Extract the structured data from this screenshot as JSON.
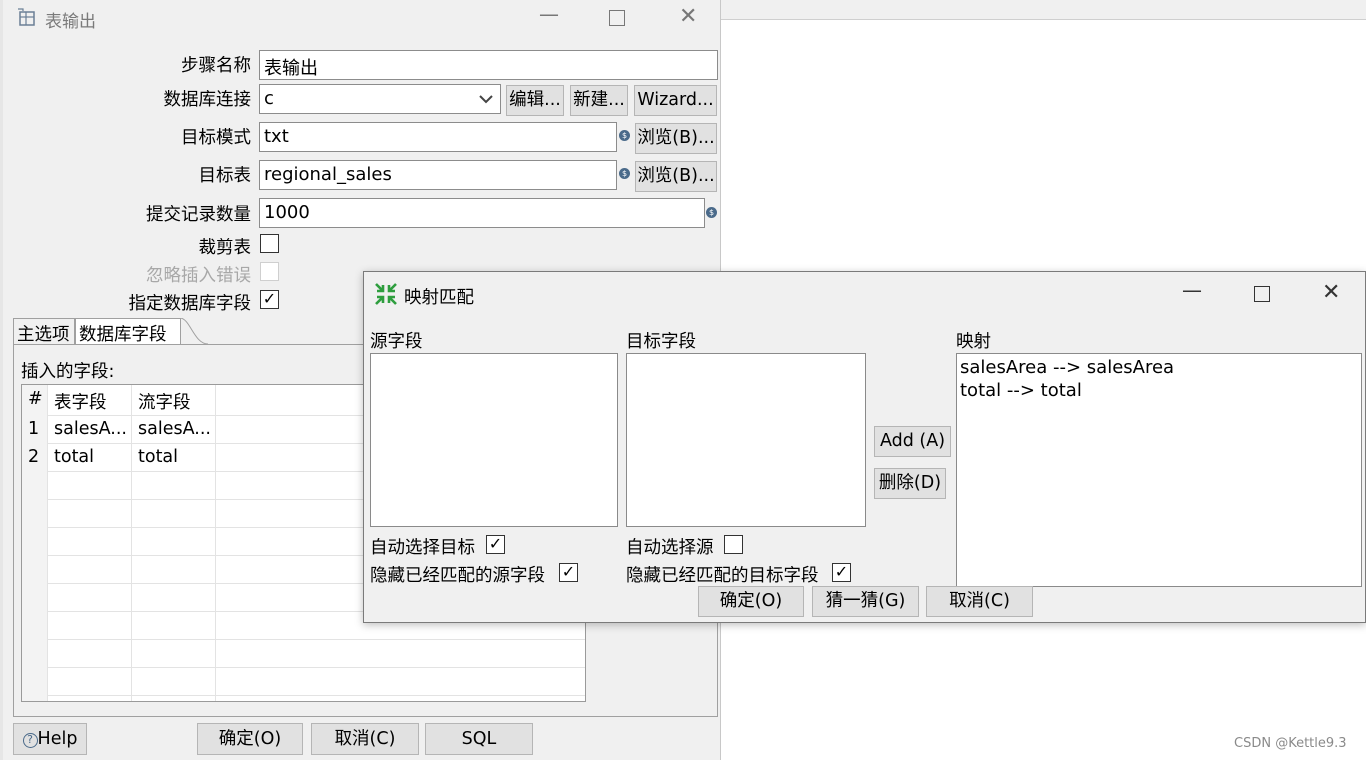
{
  "main_window": {
    "title": "表输出",
    "fields": {
      "step_name": {
        "label": "步骤名称",
        "value": "表输出"
      },
      "connection": {
        "label": "数据库连接",
        "value": "c"
      },
      "target_schema": {
        "label": "目标模式",
        "value": "txt"
      },
      "target_table": {
        "label": "目标表",
        "value": "regional_sales"
      },
      "commit_size": {
        "label": "提交记录数量",
        "value": "1000"
      },
      "truncate": {
        "label": "裁剪表",
        "checked": false
      },
      "ignore_errors": {
        "label": "忽略插入错误",
        "checked": false
      },
      "specify_fields": {
        "label": "指定数据库字段",
        "checked": true,
        "check_mark": "✓"
      }
    },
    "buttons": {
      "edit": "编辑...",
      "new": "新建...",
      "wizard": "Wizard...",
      "browse_schema": "浏览(B)...",
      "browse_table": "浏览(B)...",
      "help": "Help",
      "ok": "确定(O)",
      "cancel": "取消(C)",
      "sql": "SQL"
    },
    "var_icon": "$",
    "tabs": [
      "主选项",
      "数据库字段"
    ],
    "insert_fields_label": "插入的字段:",
    "table": {
      "headers": [
        "#",
        "表字段",
        "流字段"
      ],
      "rows": [
        {
          "num": "1",
          "table_field": "salesA...",
          "stream_field": "salesA..."
        },
        {
          "num": "2",
          "table_field": "total",
          "stream_field": "total"
        }
      ]
    }
  },
  "mapping_dialog": {
    "title": "映射匹配",
    "source_label": "源字段",
    "target_label": "目标字段",
    "mapping_label": "映射",
    "mappings": [
      "salesArea --> salesArea",
      "total --> total"
    ],
    "add_button": "Add (A)",
    "delete_button": "删除(D)",
    "auto_target": {
      "label": "自动选择目标",
      "checked": true
    },
    "hide_source": {
      "label": "隐藏已经匹配的源字段",
      "checked": true
    },
    "auto_source": {
      "label": "自动选择源",
      "checked": false
    },
    "hide_target": {
      "label": "隐藏已经匹配的目标字段",
      "checked": true
    },
    "ok_button": "确定(O)",
    "guess_button": "猜一猜(G)",
    "cancel_button": "取消(C)"
  },
  "watermark": "CSDN @Kettle9.3",
  "colors": {
    "dialog_icon": "#2e9e3e",
    "window_bg": "#f0f0f0",
    "button_bg": "#e1e1e1"
  }
}
